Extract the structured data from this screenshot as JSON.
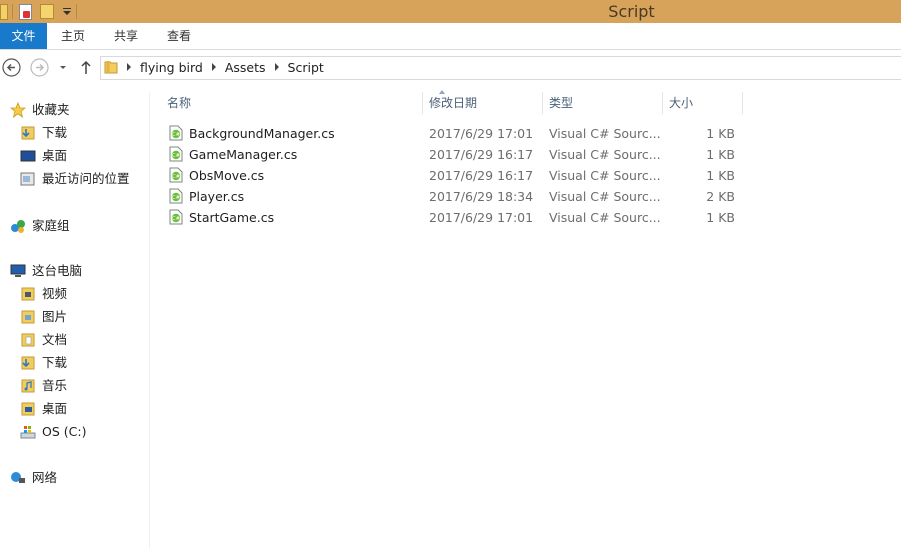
{
  "window": {
    "title": "Script"
  },
  "ribbon": {
    "tabs": [
      {
        "label": "文件"
      },
      {
        "label": "主页"
      },
      {
        "label": "共享"
      },
      {
        "label": "查看"
      }
    ]
  },
  "address": {
    "breadcrumbs": [
      "flying bird",
      "Assets",
      "Script"
    ]
  },
  "nav": {
    "favorites": {
      "label": "收藏夹",
      "items": [
        {
          "label": "下载"
        },
        {
          "label": "桌面"
        },
        {
          "label": "最近访问的位置"
        }
      ]
    },
    "homegroup": {
      "label": "家庭组"
    },
    "thispc": {
      "label": "这台电脑",
      "items": [
        {
          "label": "视频"
        },
        {
          "label": "图片"
        },
        {
          "label": "文档"
        },
        {
          "label": "下载"
        },
        {
          "label": "音乐"
        },
        {
          "label": "桌面"
        },
        {
          "label": "OS (C:)"
        }
      ]
    },
    "network": {
      "label": "网络"
    }
  },
  "columns": {
    "name": "名称",
    "date": "修改日期",
    "type": "类型",
    "size": "大小"
  },
  "files": [
    {
      "name": "BackgroundManager.cs",
      "date": "2017/6/29 17:01",
      "type": "Visual C# Sourc...",
      "size": "1 KB"
    },
    {
      "name": "GameManager.cs",
      "date": "2017/6/29 16:17",
      "type": "Visual C# Sourc...",
      "size": "1 KB"
    },
    {
      "name": "ObsMove.cs",
      "date": "2017/6/29 16:17",
      "type": "Visual C# Sourc...",
      "size": "1 KB"
    },
    {
      "name": "Player.cs",
      "date": "2017/6/29 18:34",
      "type": "Visual C# Sourc...",
      "size": "2 KB"
    },
    {
      "name": "StartGame.cs",
      "date": "2017/6/29 17:01",
      "type": "Visual C# Sourc...",
      "size": "1 KB"
    }
  ],
  "colors": {
    "titlebar": "#d7a35b",
    "file_tab": "#1979ca",
    "header_text": "#4c607a"
  }
}
